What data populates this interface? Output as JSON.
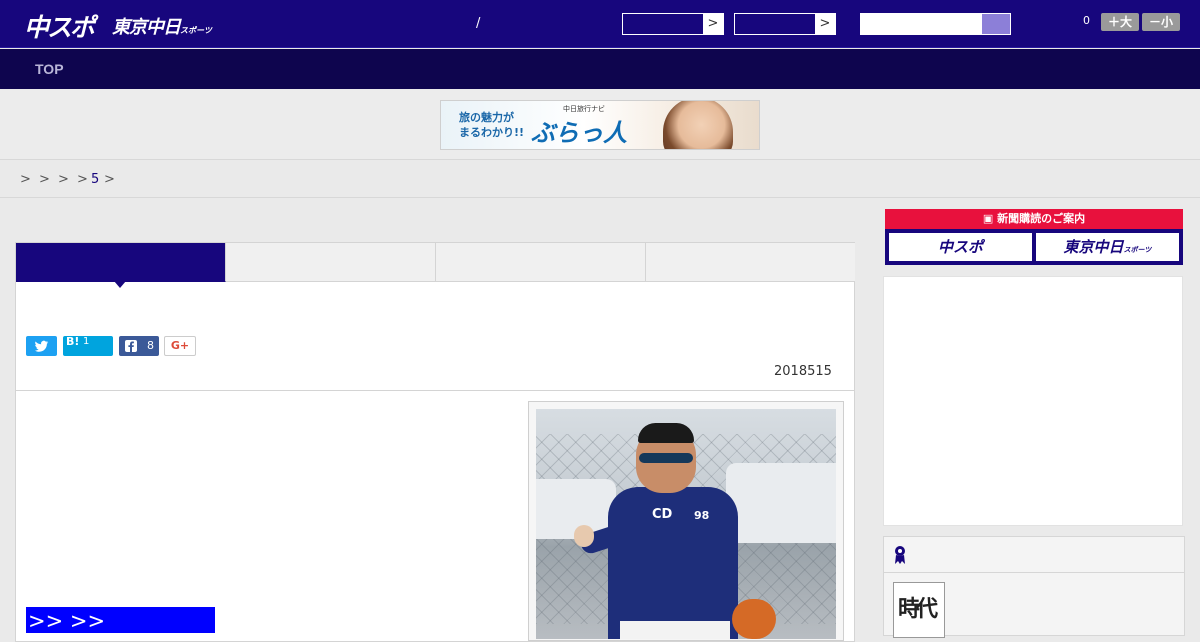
{
  "header": {
    "logo_main": "中スポ",
    "logo_secondary": "東京中日",
    "logo_secondary_small": "スポーツ",
    "slash": "/",
    "select1_arrow": ">",
    "select2_arrow": ">",
    "count": "0",
    "font_larger": "＋大",
    "font_smaller": "－小"
  },
  "nav": {
    "top_label": "TOP"
  },
  "banner": {
    "line1": "旅の魅力が",
    "line2": "まるわかり!!",
    "brand_small": "中日旅行ナビ",
    "brand_name": "ぶらっ人"
  },
  "breadcrumb": {
    "sep1": ">",
    "sep2": ">",
    "sep3": ">",
    "sep4": ">",
    "current": "5",
    "sep5": ">"
  },
  "article": {
    "share": {
      "hatena_label": "B!",
      "hatena_count": "1",
      "facebook_count": "8",
      "gplus_label": "G+"
    },
    "date": "2018515",
    "more_link": ">> >>",
    "photo": {
      "jersey_number": "98",
      "cap_logo": "CD"
    }
  },
  "sidebar": {
    "subscription_title": "新聞購読のご案内",
    "chuspo": "中スポ",
    "tokyo_chunichi": "東京中日",
    "tokyo_chunichi_small": "スポーツ",
    "ranking_thumb_text": "時代"
  },
  "colors": {
    "brand_navy": "#17067d",
    "nav_dark": "#0e054e",
    "subscribe_red": "#e8113d",
    "link_blue": "#0000ff"
  }
}
